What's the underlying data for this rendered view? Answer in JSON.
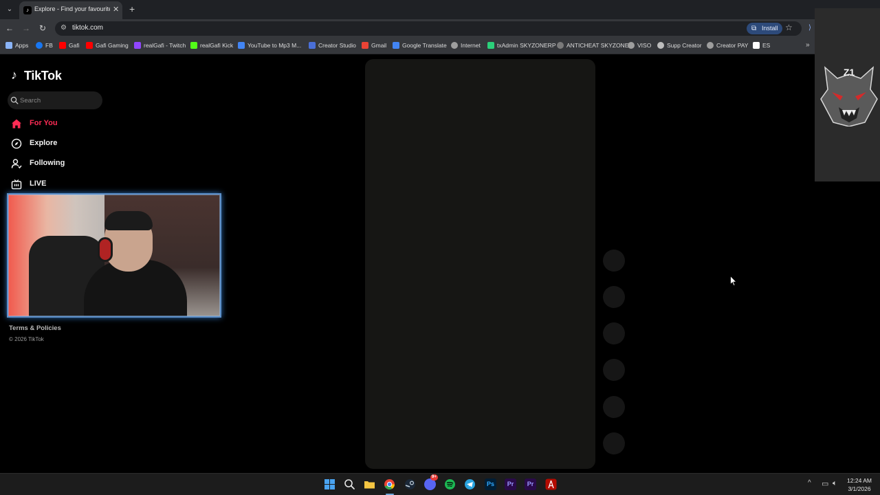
{
  "browser": {
    "tab": {
      "title": "Explore - Find your favourite vi",
      "close": "✕",
      "new_tab": "+"
    },
    "tab_menu": "⌄",
    "nav": {
      "back": "←",
      "forward": "→",
      "reload": "↻"
    },
    "url": "tiktok.com",
    "install_label": "Install",
    "star": "☆",
    "bookmarks": [
      {
        "label": "Apps",
        "color": "#8ab4f8"
      },
      {
        "label": "FB",
        "color": "#1877f2"
      },
      {
        "label": "Gafi",
        "color": "#ff0000"
      },
      {
        "label": "Gafi Gaming",
        "color": "#ff0000"
      },
      {
        "label": "realGafi - Twitch",
        "color": "#9146ff"
      },
      {
        "label": "realGafi Kick",
        "color": "#53fc18"
      },
      {
        "label": "YouTube to Mp3 M...",
        "color": "#4285f4"
      },
      {
        "label": "Creator Studio",
        "color": "#4a6fd8"
      },
      {
        "label": "Gmail",
        "color": "#ea4335"
      },
      {
        "label": "Google Translate",
        "color": "#4285f4"
      },
      {
        "label": "Internet",
        "color": "#9e9e9e"
      },
      {
        "label": "txAdmin SKYZONERP",
        "color": "#2bd07a"
      },
      {
        "label": "ANTICHEAT SKYZONE",
        "color": "#7a7a7a"
      },
      {
        "label": "VISO",
        "color": "#9e9e9e"
      },
      {
        "label": "Supp Creator",
        "color": "#bdbdbd"
      },
      {
        "label": "Creator PAY",
        "color": "#9e9e9e"
      },
      {
        "label": "ES",
        "color": "#ffffff"
      }
    ],
    "bookmarks_more": "»"
  },
  "tiktok": {
    "logo_text": "TikTok",
    "search_placeholder": "Search",
    "nav": [
      {
        "label": "For You",
        "icon": "home-icon"
      },
      {
        "label": "Explore",
        "icon": "compass-icon"
      },
      {
        "label": "Following",
        "icon": "following-icon"
      },
      {
        "label": "LIVE",
        "icon": "live-tv-icon"
      }
    ],
    "terms": "Terms & Policies",
    "copyright": "© 2026 TikTok"
  },
  "overlay": {
    "logo_text": "Z1"
  },
  "taskbar": {
    "apps": [
      {
        "name": "start",
        "label": "",
        "color": "#4aa3f0"
      },
      {
        "name": "search",
        "label": "",
        "color": "transparent"
      },
      {
        "name": "file-explorer",
        "label": "",
        "color": "#f5c542"
      },
      {
        "name": "chrome",
        "label": "",
        "color": "#34a853"
      },
      {
        "name": "steam",
        "label": "",
        "color": "#1b2838"
      },
      {
        "name": "discord",
        "label": "",
        "color": "#5865f2"
      },
      {
        "name": "spotify",
        "label": "",
        "color": "#1db954"
      },
      {
        "name": "telegram",
        "label": "",
        "color": "#2aa3de"
      },
      {
        "name": "photoshop",
        "label": "Ps",
        "color": "#001e36"
      },
      {
        "name": "premiere-1",
        "label": "Pr",
        "color": "#2a0a4a"
      },
      {
        "name": "premiere-2",
        "label": "Pr",
        "color": "#2a0a4a"
      },
      {
        "name": "acrobat",
        "label": "",
        "color": "#b30b00"
      }
    ],
    "discord_badge": "9+",
    "tray_chevron": "^",
    "time": "12:24 AM",
    "date": "3/1/2026"
  }
}
